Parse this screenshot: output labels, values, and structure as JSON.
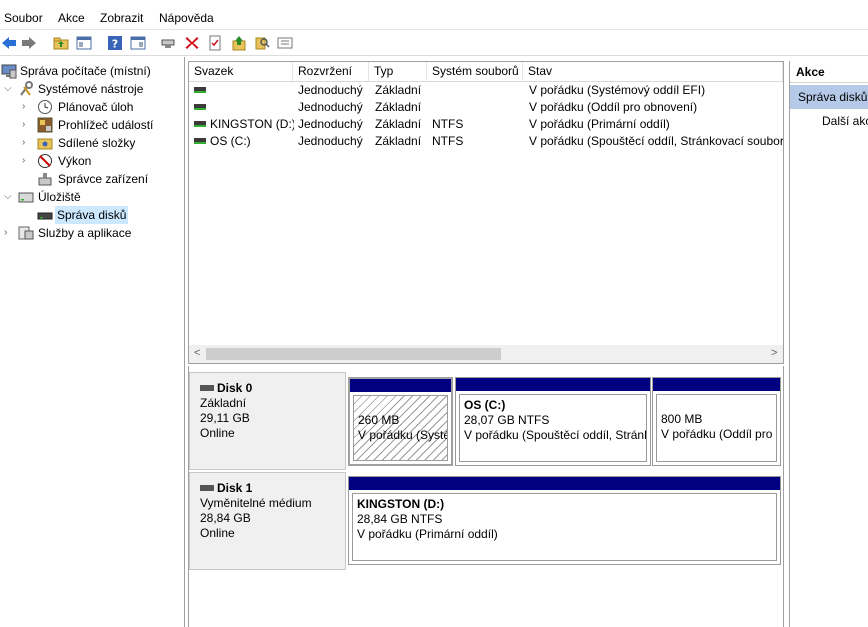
{
  "menu": [
    "Soubor",
    "Akce",
    "Zobrazit",
    "Nápověda"
  ],
  "toolbar": {
    "icons": [
      "back-arrow-icon",
      "forward-arrow-icon",
      "up-folder-icon",
      "show-hide-tree-icon",
      "help-icon",
      "show-hide-action-pane-icon",
      "connect-icon",
      "delete-icon",
      "properties-icon",
      "import-icon",
      "search-icon",
      "details-icon"
    ],
    "colors": {
      "back": "#2a6fd6",
      "delete": "#d0121b"
    }
  },
  "tree": {
    "root": "Správa počítače (místní)",
    "system_tools": "Systémové nástroje",
    "task_scheduler": "Plánovač úloh",
    "event_viewer": "Prohlížeč událostí",
    "shared_folders": "Sdílené složky",
    "performance": "Výkon",
    "device_manager": "Správce zařízení",
    "storage": "Úložiště",
    "disk_management": "Správa disků",
    "services_apps": "Služby a aplikace"
  },
  "volumes": {
    "columns": [
      "Svazek",
      "Rozvržení",
      "Typ",
      "Systém souborů",
      "Stav"
    ],
    "rows": [
      {
        "name": "",
        "layout": "Jednoduchý",
        "type": "Základní",
        "fs": "",
        "status": "V pořádku (Systémový oddíl EFI)"
      },
      {
        "name": "",
        "layout": "Jednoduchý",
        "type": "Základní",
        "fs": "",
        "status": "V pořádku (Oddíl pro obnovení)"
      },
      {
        "name": "KINGSTON (D:)",
        "layout": "Jednoduchý",
        "type": "Základní",
        "fs": "NTFS",
        "status": "V pořádku (Primární oddíl)"
      },
      {
        "name": "OS (C:)",
        "layout": "Jednoduchý",
        "type": "Základní",
        "fs": "NTFS",
        "status": "V pořádku (Spouštěcí oddíl, Stránkovací soubor,"
      }
    ]
  },
  "disks": {
    "disk0": {
      "name": "Disk 0",
      "type": "Základní",
      "size": "29,11 GB",
      "state": "Online",
      "partitions": [
        {
          "size": "260 MB",
          "status": "V pořádku (Systé"
        },
        {
          "title": "OS  (C:)",
          "size": "28,07 GB NTFS",
          "status": "V pořádku (Spouštěcí oddíl, Stránk"
        },
        {
          "size": "800 MB",
          "status": "V pořádku (Oddíl pro"
        }
      ]
    },
    "disk1": {
      "name": "Disk 1",
      "type": "Vyměnitelné médium",
      "size": "28,84 GB",
      "state": "Online",
      "partitions": [
        {
          "title": "KINGSTON  (D:)",
          "size": "28,84 GB NTFS",
          "status": "V pořádku (Primární oddíl)"
        }
      ]
    },
    "colors": {
      "primary_bar": "#000080"
    }
  },
  "actions": {
    "header": "Akce",
    "section": "Správa disků",
    "more": "Další akc"
  }
}
